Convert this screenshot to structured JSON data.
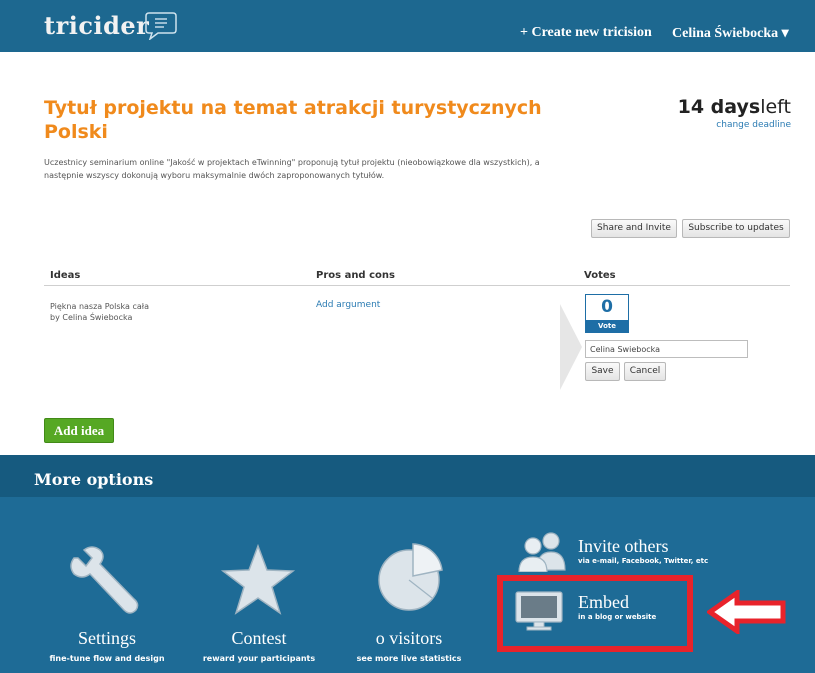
{
  "header": {
    "logo": "tricider",
    "create_link": "+ Create new tricision",
    "user_menu": "Celina Świebocka ▾"
  },
  "tricision": {
    "title": "Tytuł projektu na temat atrakcji turystycznych Polski",
    "days_number": "14 days",
    "days_suffix": "left",
    "change_deadline": "change deadline",
    "description": "Uczestnicy seminarium online \"Jakość w projektach eTwinning\" proponują tytuł projektu (nieobowiązkowe dla wszystkich), a następnie wszyscy dokonują wyboru maksymalnie dwóch zaproponowanych tytułów."
  },
  "actions": {
    "share": "Share and Invite",
    "subscribe": "Subscribe to updates"
  },
  "table": {
    "headers": {
      "ideas": "Ideas",
      "pros": "Pros and cons",
      "votes": "Votes"
    },
    "row": {
      "idea": "Piękna nasza Polska cała",
      "author": "by Celina Świebocka",
      "add_argument": "Add argument",
      "vote_count": "0",
      "vote_label": "Vote",
      "voter_name": "Celina Swiebocka",
      "save": "Save",
      "cancel": "Cancel"
    }
  },
  "add_idea": "Add idea",
  "more_options": {
    "title": "More options",
    "settings": {
      "label": "Settings",
      "sub": "fine-tune flow and design",
      "icon": "wrench-icon"
    },
    "contest": {
      "label": "Contest",
      "sub": "reward your participants",
      "icon": "star-icon"
    },
    "visitors": {
      "label": "o visitors",
      "sub": "see more live statistics",
      "icon": "pie-chart-icon"
    },
    "invite": {
      "label": "Invite others",
      "sub": "via e-mail, Facebook, Twitter, etc",
      "icon": "people-icon"
    },
    "embed": {
      "label": "Embed",
      "sub": "in a blog or website",
      "icon": "monitor-icon"
    }
  },
  "colors": {
    "header_bg": "#1d6890",
    "title_orange": "#f08a1c",
    "link_blue": "#2c7cb3",
    "add_idea_green": "#56a824",
    "options_bg": "#1e6b96",
    "highlight_red": "#e8232b"
  }
}
